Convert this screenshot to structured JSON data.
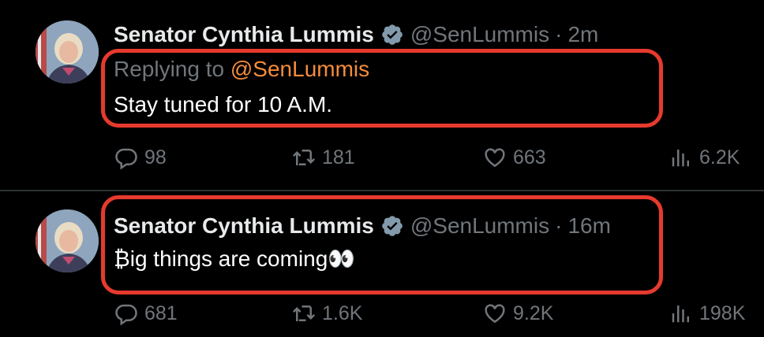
{
  "tweets": [
    {
      "author_name": "Senator Cynthia Lummis",
      "handle": "@SenLummis",
      "separator": "·",
      "time": "2m",
      "reply_prefix": "Replying to",
      "reply_to": "@SenLummis",
      "text": "Stay tuned for 10 A.M.",
      "replies": "98",
      "retweets": "181",
      "likes": "663",
      "views": "6.2K"
    },
    {
      "author_name": "Senator Cynthia Lummis",
      "handle": "@SenLummis",
      "separator": "·",
      "time": "16m",
      "text": "₿ig things are coming👀",
      "replies": "681",
      "retweets": "1.6K",
      "likes": "9.2K",
      "views": "198K"
    }
  ],
  "colors": {
    "background": "#000000",
    "muted": "#71767b",
    "mention": "#f48c3c",
    "highlight": "#e63a2e",
    "verified_badge": "#829aab"
  },
  "icons": [
    "reply-icon",
    "retweet-icon",
    "like-icon",
    "views-icon",
    "verified-badge-icon"
  ]
}
